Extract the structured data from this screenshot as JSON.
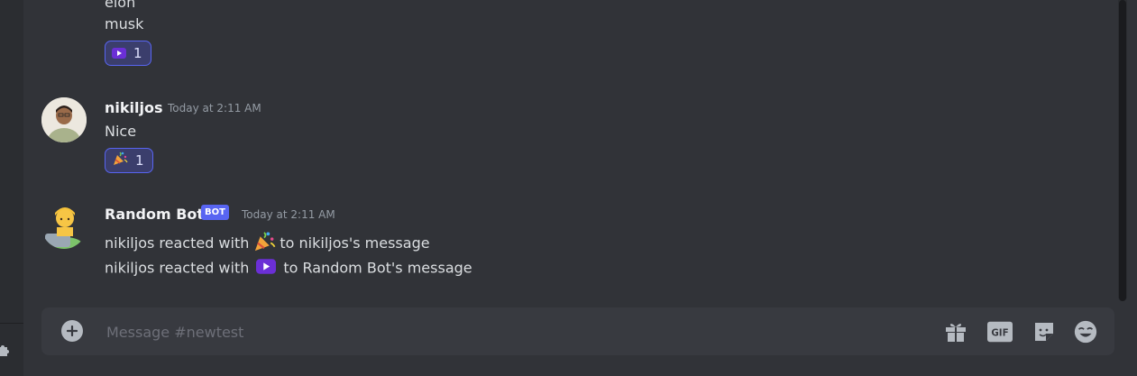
{
  "messages": [
    {
      "lines": [
        "elon",
        "musk"
      ],
      "reaction": {
        "emoji": "youtube-play-emoji",
        "count": "1"
      }
    },
    {
      "username": "nikiljos",
      "timestamp": "Today at 2:11 AM",
      "text": "Nice",
      "reaction": {
        "emoji": "party-popper-emoji",
        "count": "1"
      }
    },
    {
      "username": "Random Bot",
      "bot_tag": "BOT",
      "timestamp": "Today at 2:11 AM",
      "lines": [
        {
          "before": "nikiljos reacted with",
          "emoji": "party-popper-emoji",
          "after": "to nikiljos's message"
        },
        {
          "before": "nikiljos reacted with",
          "emoji": "youtube-play-emoji",
          "after": "to Random Bot's message"
        }
      ]
    }
  ],
  "composer": {
    "placeholder": "Message #newtest",
    "gif_label": "GIF",
    "icons": [
      "add-attachment-icon",
      "gift-icon",
      "gif-icon",
      "sticker-icon",
      "emoji-icon"
    ]
  },
  "colors": {
    "background": "#313338",
    "sidebar": "#2b2d31",
    "accent": "#5865f2",
    "reaction_bg": "#3b3e6c",
    "composer_bg": "#383a40"
  }
}
